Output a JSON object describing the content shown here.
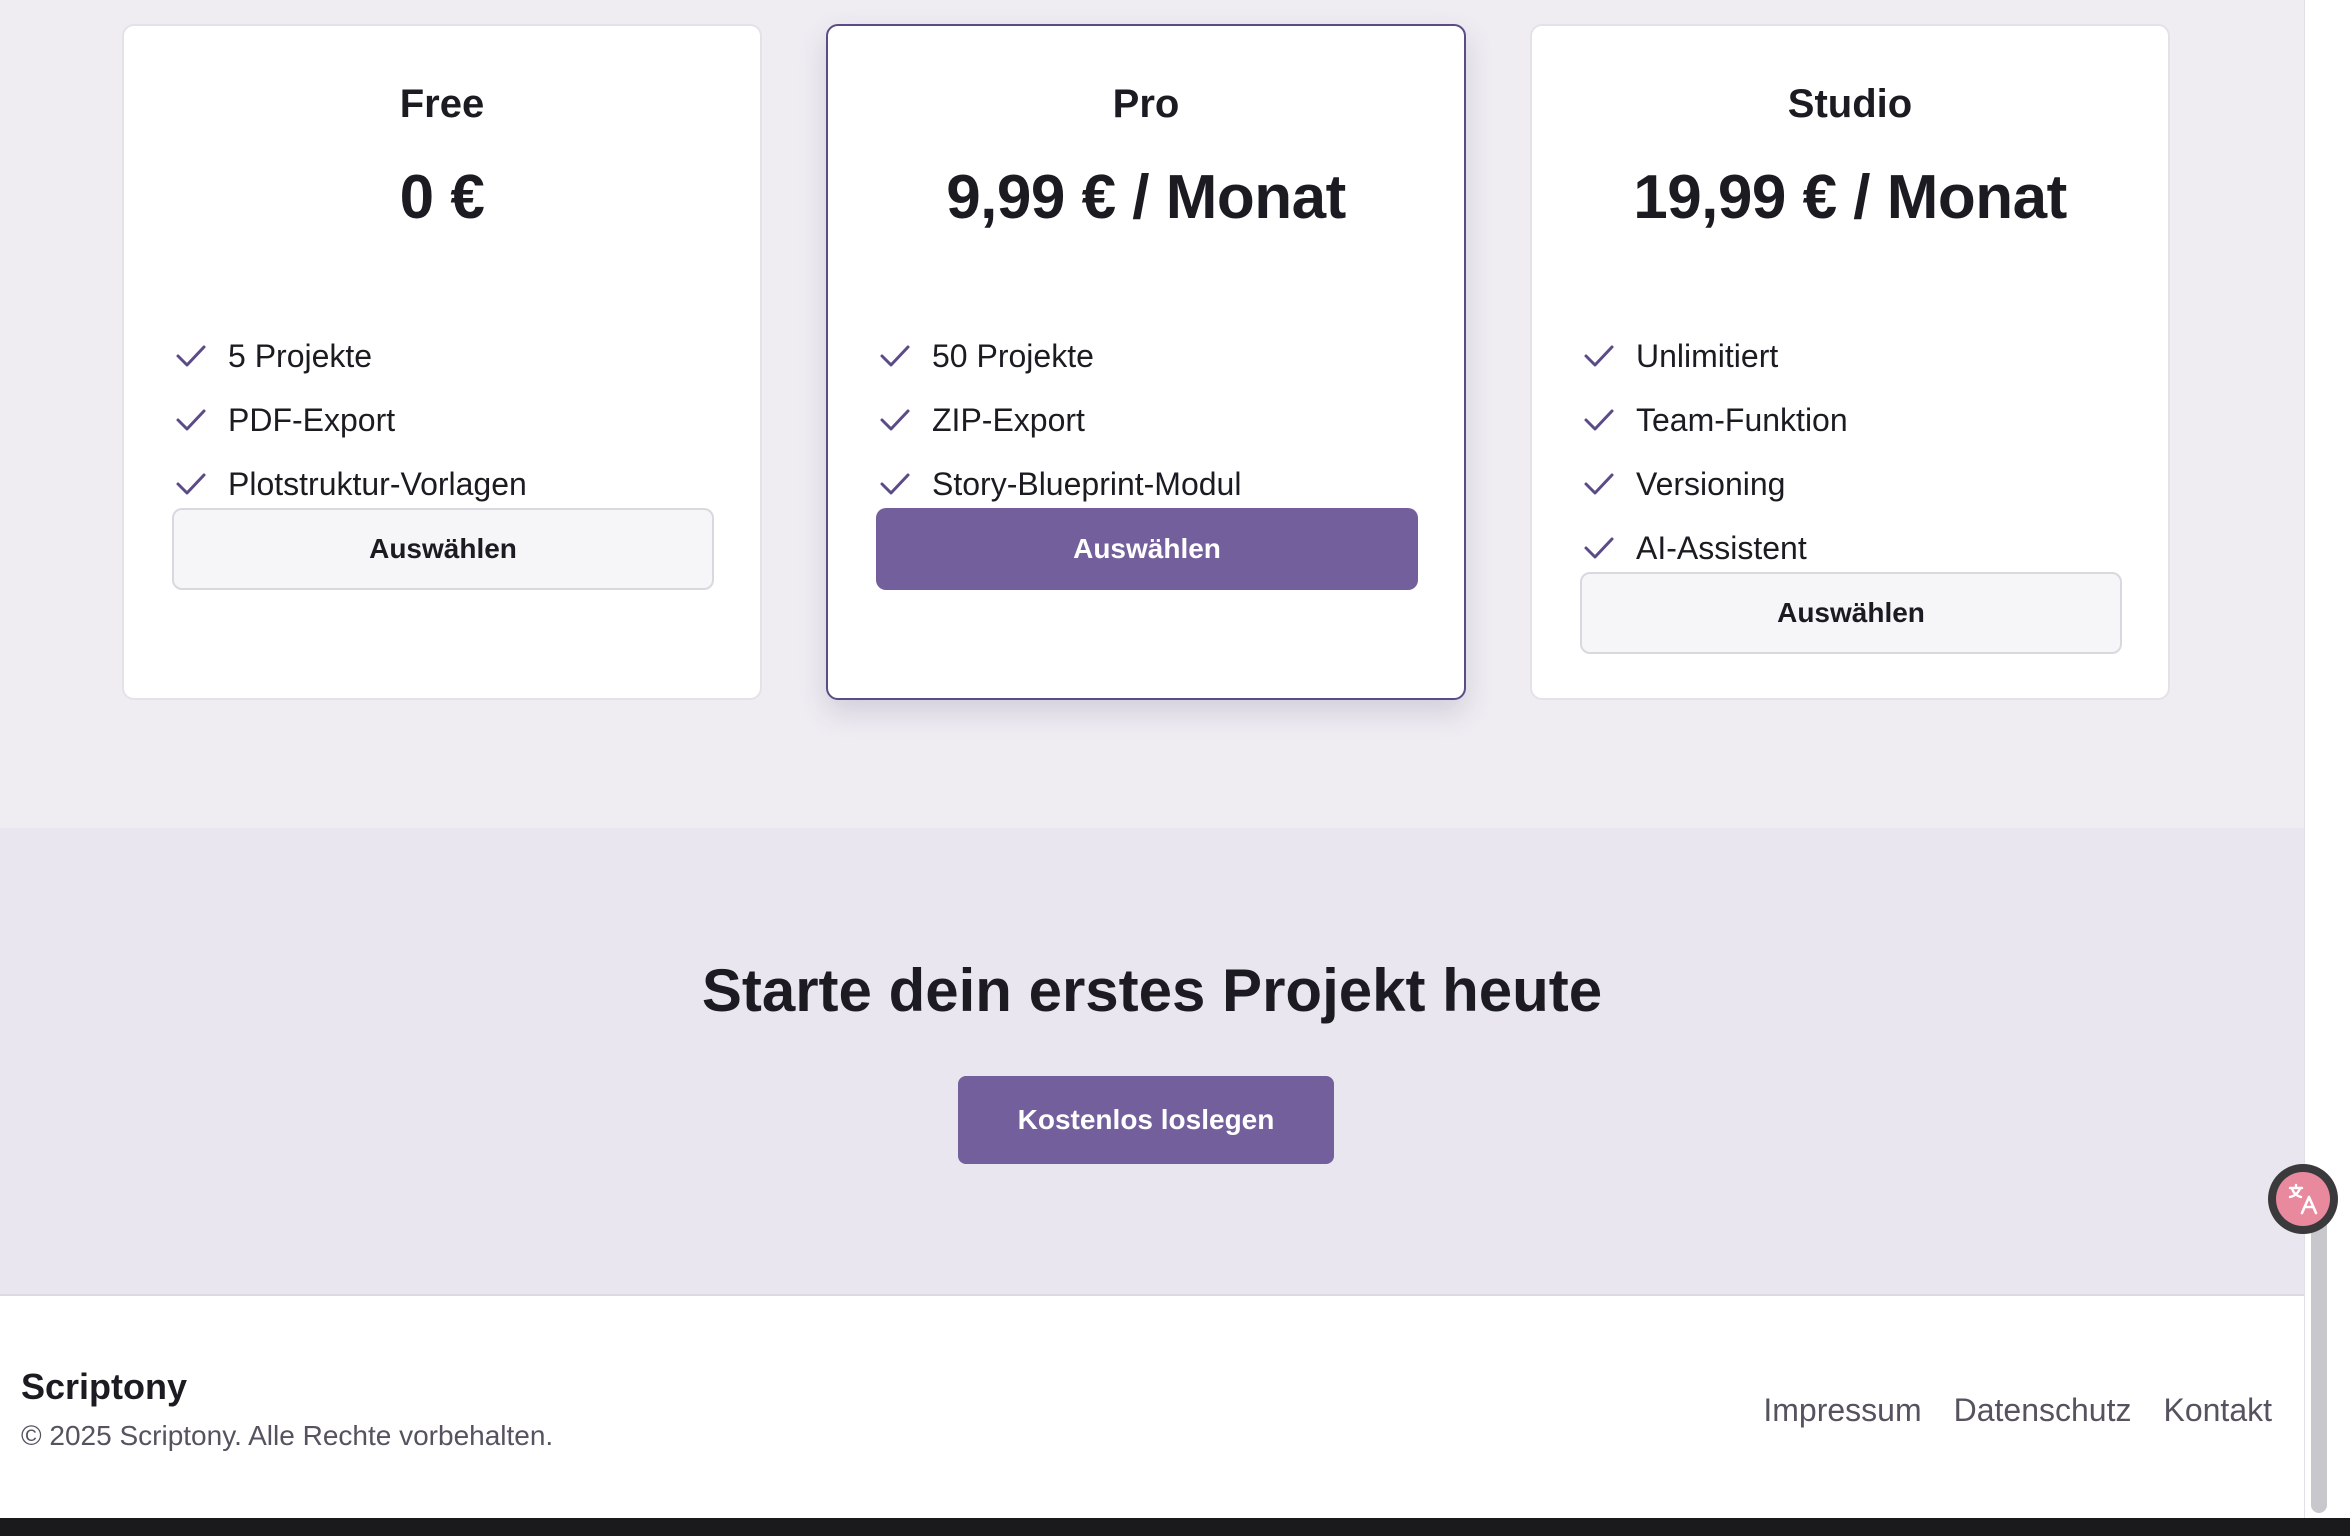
{
  "colors": {
    "accent": "#735f9b",
    "featured_border": "#5b4b86",
    "check": "#5b4b86",
    "background": "#efedf2",
    "cta_background": "#e9e6f0"
  },
  "plans": [
    {
      "name": "Free",
      "price": "0 €",
      "features": [
        "5 Projekte",
        "PDF-Export",
        "Plotstruktur-Vorlagen"
      ],
      "button_label": "Auswählen"
    },
    {
      "name": "Pro",
      "price": "9,99 € / Monat",
      "features": [
        "50 Projekte",
        "ZIP-Export",
        "Story-Blueprint-Modul"
      ],
      "button_label": "Auswählen"
    },
    {
      "name": "Studio",
      "price": "19,99 € / Monat",
      "features": [
        "Unlimitiert",
        "Team-Funktion",
        "Versioning",
        "AI-Assistent"
      ],
      "button_label": "Auswählen"
    }
  ],
  "cta": {
    "title": "Starte dein erstes Projekt heute",
    "button_label": "Kostenlos loslegen"
  },
  "footer": {
    "brand": "Scriptony",
    "copyright": "© 2025 Scriptony. Alle Rechte vorbehalten.",
    "links": [
      "Impressum",
      "Datenschutz",
      "Kontakt"
    ]
  },
  "icons": {
    "check": "check-icon",
    "translate": "translate-icon"
  }
}
